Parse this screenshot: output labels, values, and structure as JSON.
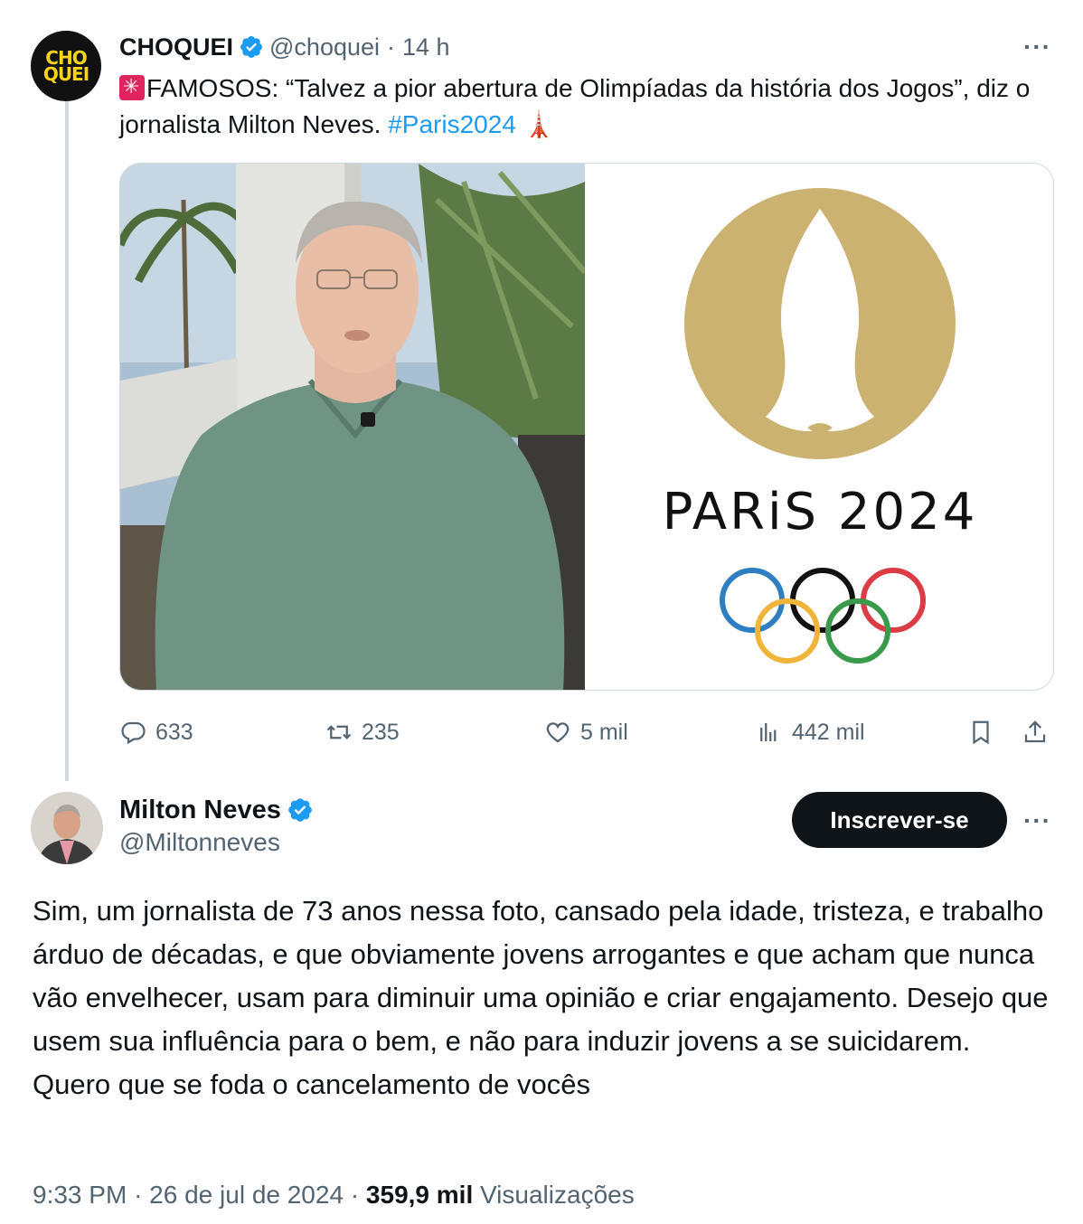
{
  "parent_tweet": {
    "name": "CHOQUEI",
    "avatar_text": [
      "CHO",
      "QUEI"
    ],
    "handle": "@choquei",
    "separator": "·",
    "time": "14 h",
    "more": "···",
    "text_main": "FAMOSOS: “Talvez a pior abertura de Olimpíadas da história dos Jogos”, diz o jornalista Milton Neves. ",
    "hashtag": "#Paris2024",
    "emoji": "🗼",
    "media_logo_text": "PARiS 2024",
    "stats": {
      "replies": "633",
      "reposts": "235",
      "likes": "5 mil",
      "views": "442 mil"
    }
  },
  "main_tweet": {
    "name": "Milton Neves",
    "handle": "@Miltonneves",
    "subscribe_label": "Inscrever-se",
    "more": "···",
    "text": "Sim, um jornalista de 73 anos nessa foto, cansado pela idade, tristeza, e trabalho árduo de décadas, e que obviamente jovens arrogantes e que acham que nunca vão envelhecer, usam para diminuir uma opinião e criar engajamento. Desejo que usem sua influência para o bem, e não para induzir jovens a se suicidarem. Quero que se foda o cancelamento de vocês",
    "time": "9:33 PM",
    "sep1": "·",
    "date": "26 de jul de 2024",
    "sep2": "·",
    "views_count": "359,9 mil",
    "views_label": "Visualizações"
  },
  "colors": {
    "accent": "#1d9bf0",
    "verified": "#1d9bf0",
    "muted": "#536471",
    "olympic_gold": "#cbb271"
  }
}
